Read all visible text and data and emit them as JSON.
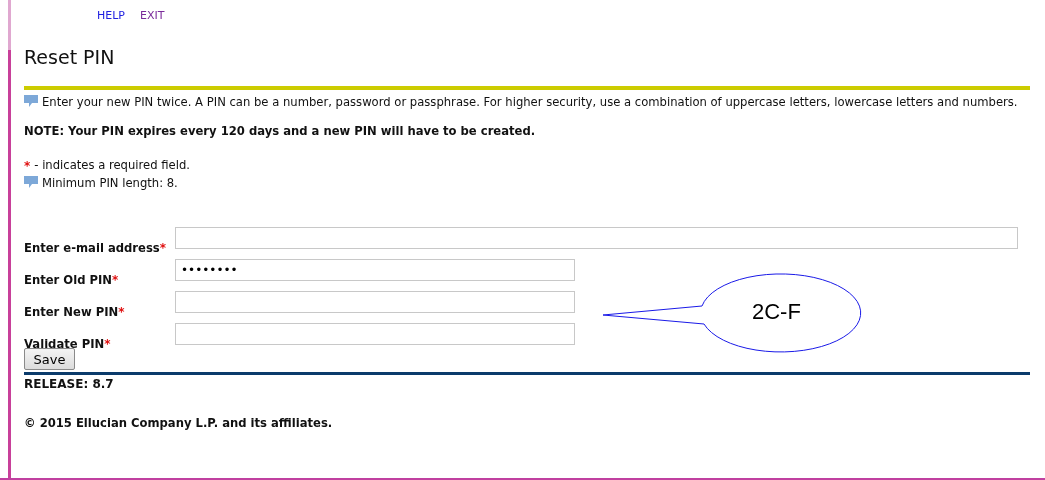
{
  "nav": [
    {
      "label": "HELP",
      "visited": false
    },
    {
      "label": "EXIT",
      "visited": true
    }
  ],
  "title": "Reset PIN",
  "info": "Enter your new PIN twice. A PIN can be a number, password or passphrase. For higher security, use a combination of uppercase letters, lowercase letters and numbers.",
  "note": "NOTE: Your PIN expires every 120 days and a new PIN will have to be created.",
  "required_legend": {
    "mark": "*",
    "text": "- indicates a required field."
  },
  "min_length": "Minimum PIN length: 8.",
  "fields": [
    {
      "label": "Enter e-mail address",
      "mark": "*"
    },
    {
      "label": "Enter Old PIN",
      "mark": "*",
      "value": "••••••••"
    },
    {
      "label": "Enter New PIN",
      "mark": "*"
    },
    {
      "label": "Validate PIN",
      "mark": "*"
    }
  ],
  "save_button": "Save",
  "release": "RELEASE: 8.7",
  "copyright": "© 2015 Ellucian Company L.P. and its affiliates.",
  "callout": {
    "text": "2C-F"
  }
}
